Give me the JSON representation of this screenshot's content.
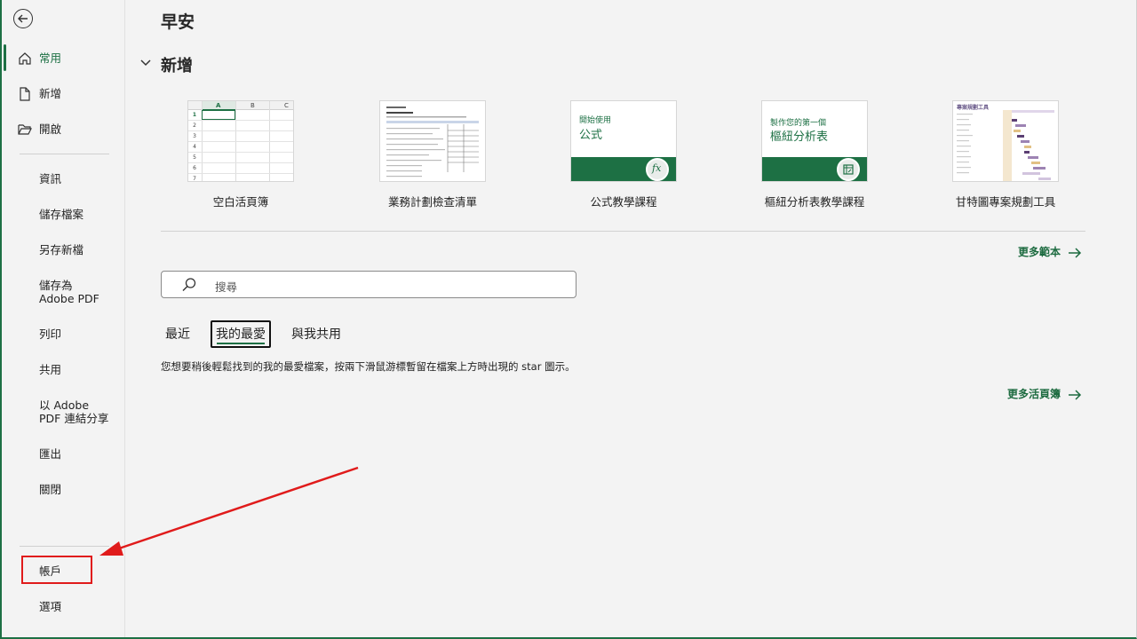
{
  "greeting": "早安",
  "sidebar": {
    "items": [
      {
        "label": "常用",
        "icon": "home-icon",
        "active": true
      },
      {
        "label": "新增",
        "icon": "new-document-icon"
      },
      {
        "label": "開啟",
        "icon": "open-folder-icon"
      },
      {
        "label": "資訊"
      },
      {
        "label": "儲存檔案"
      },
      {
        "label": "另存新檔"
      },
      {
        "label": "儲存為",
        "label2": "Adobe PDF"
      },
      {
        "label": "列印"
      },
      {
        "label": "共用"
      },
      {
        "label": "以 Adobe",
        "label2": "PDF 連結分享"
      },
      {
        "label": "匯出"
      },
      {
        "label": "關閉"
      },
      {
        "label": "帳戶"
      },
      {
        "label": "選項"
      }
    ]
  },
  "new_section": {
    "title": "新增",
    "templates": [
      {
        "caption": "空白活頁簿"
      },
      {
        "caption": "業務計劃檢查清單"
      },
      {
        "caption": "公式教學課程",
        "thumb_line1": "開始使用",
        "thumb_line2": "公式",
        "badge": "fx"
      },
      {
        "caption": "樞紐分析表教學課程",
        "thumb_line1": "製作您的第一個",
        "thumb_line2": "樞紐分析表"
      },
      {
        "caption": "甘特圖專案規劃工具",
        "thumb_title": "專案規劃工具"
      }
    ],
    "more_templates": "更多範本"
  },
  "search": {
    "placeholder": "搜尋"
  },
  "tabs": [
    {
      "label": "最近"
    },
    {
      "label": "我的最愛",
      "selected": true
    },
    {
      "label": "與我共用"
    }
  ],
  "favorites_message": "您想要稍後輕鬆找到的我的最愛檔案，按兩下滑鼠游標暫留在檔案上方時出現的 star 圖示。",
  "more_workbooks": "更多活頁簿",
  "blank_grid": {
    "columns": [
      "A",
      "B",
      "C"
    ],
    "rows": [
      "1",
      "2",
      "3",
      "4",
      "5",
      "6",
      "7",
      "8"
    ]
  },
  "colors": {
    "accent": "#1d7044",
    "annotation": "#e01b1b"
  }
}
